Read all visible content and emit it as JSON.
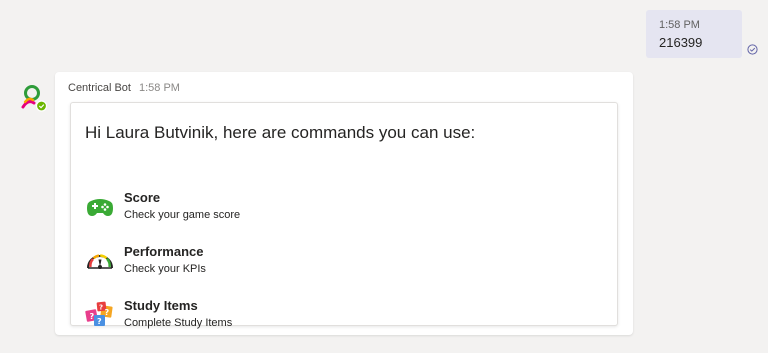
{
  "sent_message": {
    "time": "1:58 PM",
    "text": "216399",
    "status_icon": "read-check-icon"
  },
  "bot_message": {
    "sender": "Centrical Bot",
    "time": "1:58 PM",
    "avatar_icon": "centrical-logo-icon",
    "card": {
      "title": "Hi Laura Butvinik, here are commands you can use:",
      "commands": [
        {
          "title": "Score",
          "description": "Check your game score",
          "icon": "gamepad-icon"
        },
        {
          "title": "Performance",
          "description": "Check your KPIs",
          "icon": "speedometer-icon"
        },
        {
          "title": "Study Items",
          "description": "Complete Study Items",
          "icon": "question-cards-icon"
        }
      ]
    }
  },
  "colors": {
    "background": "#f3f2f1",
    "sent_bubble": "#e5e5f1",
    "card_background": "#ffffff",
    "gamepad_green": "#3aaa35",
    "presence_green": "#6bb700"
  }
}
